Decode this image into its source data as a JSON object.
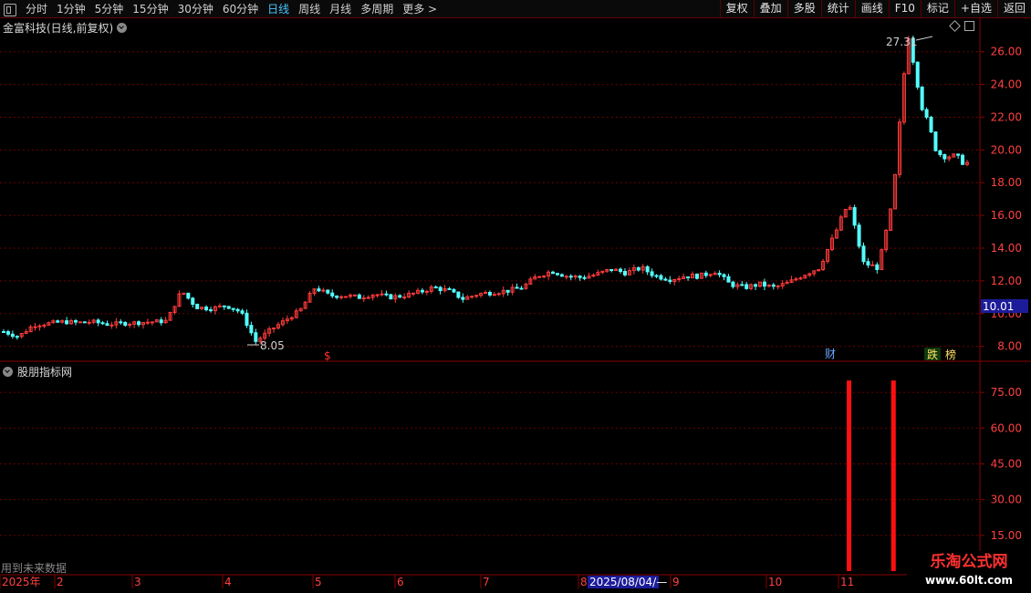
{
  "toolbar": {
    "periods": [
      "分时",
      "1分钟",
      "5分钟",
      "15分钟",
      "30分钟",
      "60分钟",
      "日线",
      "周线",
      "月线",
      "多周期",
      "更多 >"
    ],
    "active_period": "日线",
    "actions": [
      "复权",
      "叠加",
      "多股",
      "统计",
      "画线",
      "F10",
      "标记",
      "+自选",
      "返回"
    ]
  },
  "chart_title": "金富科技(日线,前复权)",
  "indicator_title": "股朋指标网",
  "future_data_note": "用到未来数据",
  "annotations": {
    "high_label": "27.31",
    "low_label": "8.05",
    "current_price": "10.01",
    "marker_dollar": "$",
    "marker_cai": "财",
    "marker_die": "跌",
    "marker_bang": "榜",
    "date_cursor": "2025/08/04/—"
  },
  "price_axis": [
    "26.00",
    "24.00",
    "22.00",
    "20.00",
    "18.00",
    "16.00",
    "14.00",
    "12.00",
    "10.00",
    "8.00"
  ],
  "indicator_axis": [
    "75.00",
    "60.00",
    "45.00",
    "30.00",
    "15.00"
  ],
  "time_axis": [
    "2025年",
    "2",
    "3",
    "4",
    "5",
    "6",
    "7",
    "8",
    "9",
    "10",
    "11"
  ],
  "watermark": {
    "title": "乐淘公式网",
    "url": "www.60lt.com"
  },
  "colors": {
    "up": "#ff3b3b",
    "down": "#54ffff",
    "grid": "#6a0000",
    "axis_text": "#ff4040",
    "highlight": "#1c1c9a"
  },
  "chart_data": {
    "type": "candlestick",
    "price_range": [
      7.2,
      27.6
    ],
    "price_path": [
      8.9,
      8.6,
      9.3,
      9.4,
      9.5,
      9.45,
      9.5,
      9.35,
      9.4,
      9.45,
      9.5,
      9.55,
      11.4,
      10.4,
      10.3,
      10.5,
      10.1,
      8.3,
      9.0,
      9.6,
      10.2,
      11.6,
      11.1,
      11.1,
      11.0,
      11.2,
      11.0,
      11.1,
      11.3,
      11.6,
      11.4,
      10.9,
      11.2,
      11.3,
      11.4,
      11.6,
      12.3,
      12.6,
      12.3,
      12.2,
      12.4,
      12.7,
      12.5,
      12.8,
      12.3,
      12.1,
      12.3,
      12.3,
      12.6,
      11.8,
      11.6,
      11.8,
      11.6,
      11.9,
      12.4,
      12.8,
      14.7,
      16.8,
      13.1,
      12.8,
      16.9,
      27.3,
      22.5,
      19.8,
      19.6,
      19.2
    ],
    "indicator_range": [
      0,
      85
    ],
    "indicator_bars": [
      {
        "x_index": 57,
        "value": 80
      },
      {
        "x_index": 60,
        "value": 80
      }
    ]
  }
}
